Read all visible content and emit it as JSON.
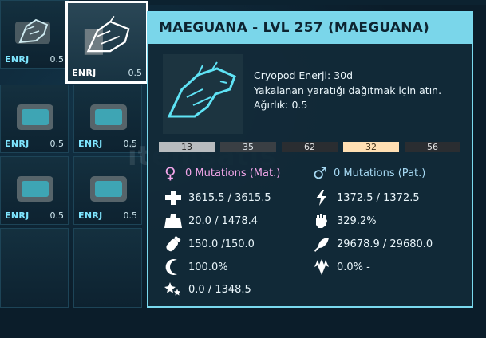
{
  "tooltip": {
    "title": "MAEGUANA - LVL 257 (MAEGUANA)",
    "info_lines": [
      "Cryopod Enerji: 30d",
      "Yakalanan yaratığı dağıtmak için atın.",
      "Ağırlık: 0.5"
    ],
    "stat_levels": [
      "13",
      "35",
      "62",
      "32",
      "56"
    ],
    "mutations": {
      "maternal": "0 Mutations (Mat.)",
      "paternal": "0 Mutations (Pat.)"
    },
    "stats_left": [
      {
        "icon": "health-cross-icon",
        "value": "3615.5 / 3615.5"
      },
      {
        "icon": "weight-icon",
        "value": "20.0 / 1478.4"
      },
      {
        "icon": "oxygen-icon",
        "value": "150.0 /150.0"
      },
      {
        "icon": "movement-icon",
        "value": "100.0%"
      },
      {
        "icon": "torpidity-icon",
        "value": "0.0 / 1348.5"
      }
    ],
    "stats_right": [
      {
        "icon": "stamina-bolt-icon",
        "value": "1372.5 / 1372.5"
      },
      {
        "icon": "melee-fist-icon",
        "value": "329.2%"
      },
      {
        "icon": "food-icon",
        "value": "29678.9 / 29680.0"
      },
      {
        "icon": "imprint-icon",
        "value": "0.0% -"
      }
    ]
  },
  "inventory": {
    "slots": [
      {
        "label": "ENRJ",
        "weight": "0.5"
      },
      {
        "label": "ENRJ",
        "weight": "0.5"
      },
      {
        "label": "ENRJ",
        "weight": "0.5"
      },
      {
        "label": "ENRJ",
        "weight": "0.5"
      },
      {
        "label": "ENRJ",
        "weight": "0.5"
      },
      {
        "label": "ENRJ",
        "weight": "0.5"
      }
    ]
  },
  "watermark": "itemsatis",
  "colors": {
    "accent": "#7ad6ea",
    "maternal": "#f3a6ea",
    "paternal": "#a6d9f3"
  }
}
